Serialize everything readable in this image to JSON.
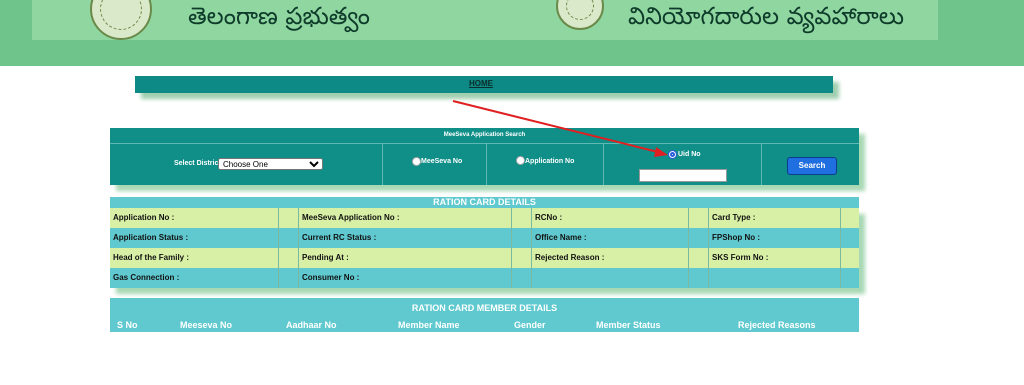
{
  "header": {
    "left_title": "తెలంగాణ ప్రభుత్వం",
    "right_title": "వినియోగదారుల వ్యవహారాలు"
  },
  "nav": {
    "home": "HOME"
  },
  "search": {
    "title": "MeeSeva Application Search",
    "district_label": "Select District :",
    "district_value": "Choose One",
    "radio_meeseva": "MeeSeva No",
    "radio_application": "Application No",
    "radio_uid": "Uid No",
    "button": "Search"
  },
  "ration_card": {
    "title": "RATION CARD DETAILS",
    "rows": [
      [
        "Application No :",
        "MeeSeva Application No :",
        "RCNo :",
        "Card Type :"
      ],
      [
        "Application Status :",
        "Current RC Status :",
        "Office Name :",
        "FPShop No :"
      ],
      [
        "Head of the Family :",
        "Pending At :",
        "Rejected Reason :",
        "SKS Form No :"
      ],
      [
        "Gas Connection :",
        "Consumer No :",
        "",
        ""
      ]
    ]
  },
  "members": {
    "title": "RATION CARD MEMBER DETAILS",
    "headers": [
      "S No",
      "Meeseva No",
      "Aadhaar No",
      "Member Name",
      "Gender",
      "Member Status",
      "Rejected Reasons"
    ]
  },
  "colors": {
    "header_green": "#6fc48c",
    "teal": "#0f8f88",
    "light_teal": "#5fc9cf",
    "lime_row": "#d8f0a5",
    "search_button": "#1f6fe0",
    "annotation_arrow": "#e02020"
  }
}
